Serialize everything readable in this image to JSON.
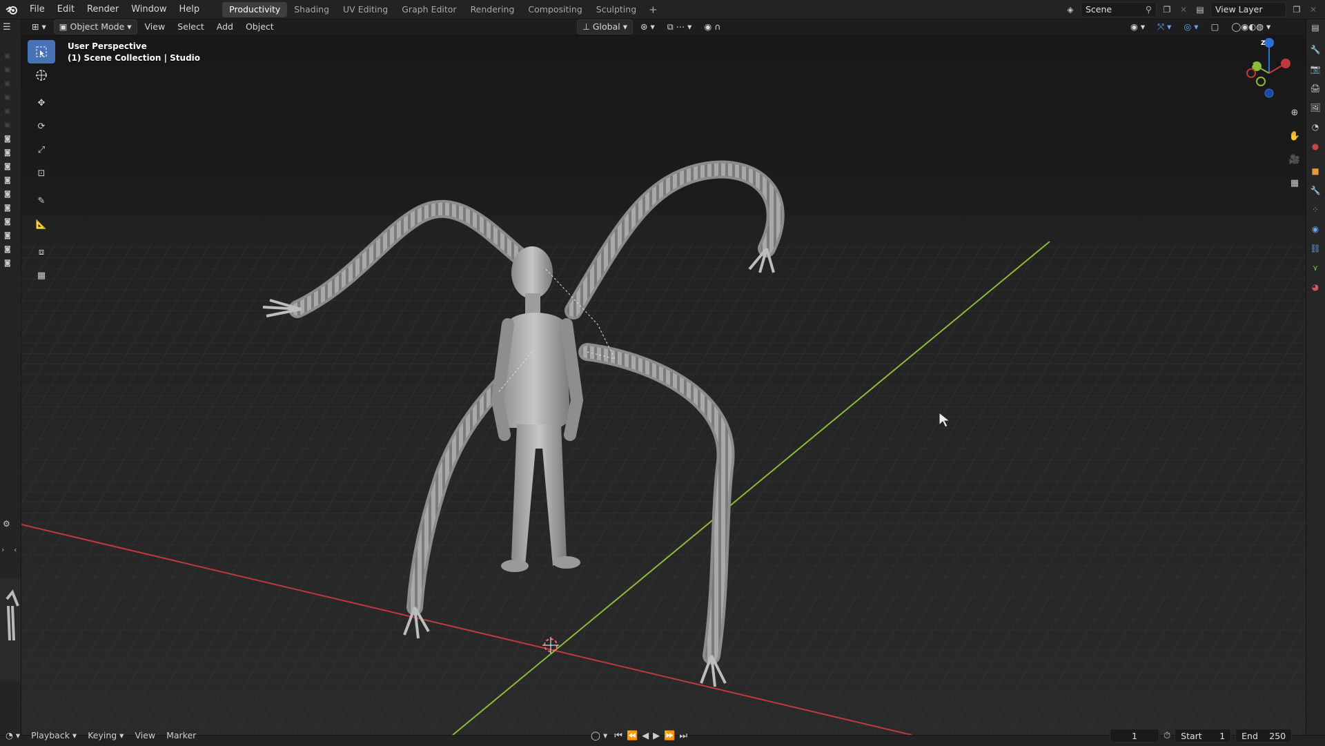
{
  "menu": {
    "items": [
      "File",
      "Edit",
      "Render",
      "Window",
      "Help"
    ]
  },
  "workspaces": {
    "tabs": [
      "Productivity",
      "Shading",
      "UV Editing",
      "Graph Editor",
      "Rendering",
      "Compositing",
      "Sculpting"
    ],
    "active": "Productivity",
    "add": "+"
  },
  "top_right": {
    "scene": "Scene",
    "view_layer": "View Layer"
  },
  "viewport_header": {
    "mode": "Object Mode",
    "menus": [
      "View",
      "Select",
      "Add",
      "Object"
    ],
    "orientation": "Global"
  },
  "overlay": {
    "perspective": "User Perspective",
    "collection": "(1) Scene Collection | Studio"
  },
  "timeline": {
    "menus": [
      "Playback",
      "Keying",
      "View",
      "Marker"
    ],
    "current_frame": "1",
    "start_label": "Start",
    "start_value": "1",
    "end_label": "End",
    "end_value": "250"
  },
  "gizmo": {
    "axes": [
      "Z",
      "Y",
      "X"
    ]
  },
  "colors": {
    "accent": "#4772b3",
    "x_axis": "#c0393f",
    "y_axis": "#8bbd3a",
    "z_axis": "#2f6fd0",
    "viewport_bg": "#393939"
  }
}
